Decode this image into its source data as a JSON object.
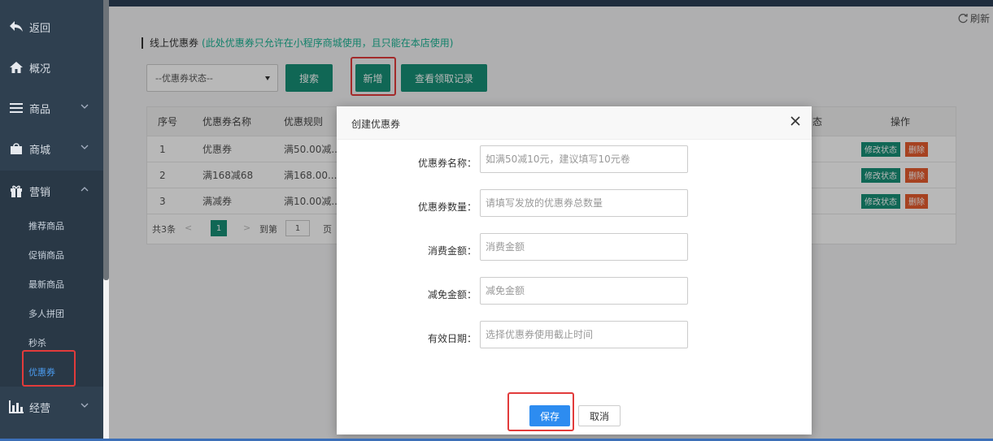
{
  "sidebar": {
    "items": [
      {
        "label": "返回",
        "icon": "back-arrow-icon"
      },
      {
        "label": "概况",
        "icon": "home-icon"
      },
      {
        "label": "商品",
        "icon": "list-icon"
      },
      {
        "label": "商城",
        "icon": "shop-icon"
      },
      {
        "label": "营销",
        "icon": "gift-icon"
      },
      {
        "label": "经营",
        "icon": "bar-chart-icon"
      }
    ],
    "sub_items": [
      "推荐商品",
      "促销商品",
      "最新商品",
      "多人拼团",
      "秒杀",
      "优惠券"
    ]
  },
  "header": {
    "refresh_label": "刷新",
    "title": "线上优惠券",
    "hint": "(此处优惠券只允许在小程序商城使用，且只能在本店使用)"
  },
  "toolbar": {
    "status_select": "--优惠券状态--",
    "search_label": "搜索",
    "add_label": "新增",
    "records_label": "查看领取记录"
  },
  "table": {
    "headers": [
      "序号",
      "优惠券名称",
      "优惠规则",
      "态",
      "操作"
    ],
    "rows": [
      {
        "no": "1",
        "name": "优惠券",
        "rule": "满50.00减..."
      },
      {
        "no": "2",
        "name": "满168减68",
        "rule": "满168.00..."
      },
      {
        "no": "3",
        "name": "满减券",
        "rule": "满10.00减..."
      }
    ],
    "edit_label": "修改状态",
    "delete_label": "删除"
  },
  "pager": {
    "total": "共3条",
    "current": "1",
    "goto_label": "到第",
    "goto_value": "1",
    "page_label": "页"
  },
  "modal": {
    "title": "创建优惠券",
    "fields": [
      {
        "label": "优惠券名称：",
        "placeholder": "如满50减10元，建议填写10元卷"
      },
      {
        "label": "优惠券数量：",
        "placeholder": "请填写发放的优惠券总数量"
      },
      {
        "label": "消费金额：",
        "placeholder": "消费金额"
      },
      {
        "label": "减免金额：",
        "placeholder": "减免金额"
      },
      {
        "label": "有效日期：",
        "placeholder": "选择优惠券使用截止时间"
      }
    ],
    "save_label": "保存",
    "cancel_label": "取消"
  },
  "colors": {
    "sidebar_bg": "#2f4050",
    "primary_green": "#178f76",
    "danger": "#e65c2f",
    "save_blue": "#2d8cf0",
    "highlight_red": "#e23b3b"
  }
}
